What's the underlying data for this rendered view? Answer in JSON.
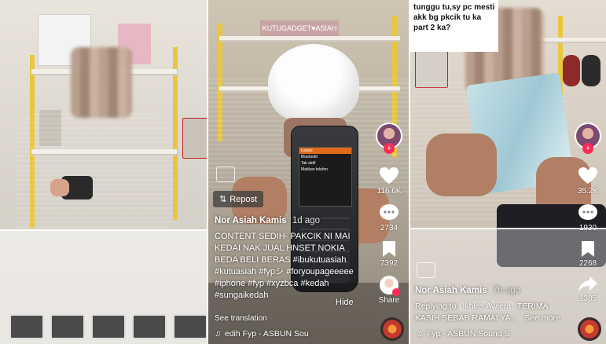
{
  "panel1": {
    "overlay_label": "KUTUGADGET ASIAH"
  },
  "panel2": {
    "sign_text": "KUTUGADGET♥ASIAH",
    "repost_label": "Repost",
    "username": "Nor Asiah Kamis",
    "time_ago": "1d ago",
    "caption_lines": [
      "CONTENT SEDIH- PAKCIK NI MAI",
      "KEDAI NAK JUAL HNSET NOKIA",
      "BEDA BELI BERAS #ibukutuasiah",
      "#kutuasiah #fypシ #foryoupageeeee",
      "#iphone #fyp #xyzbca #kedah",
      "#sungaikedah"
    ],
    "hide_label": "Hide",
    "see_translation": "See translation",
    "music": "edih Fyp - ASBUN    Sou",
    "likes": "116.6K",
    "comments": "2734",
    "saves": "7392",
    "share_label": "Share",
    "phone_screen": [
      "Lokasi",
      "Bluetooth",
      "Tak aktif",
      "Matikan telefon"
    ]
  },
  "panel3": {
    "comment_box": "tunggu tu,sy pc mesti akk bg pkcik tu ka part 2 ka?",
    "username": "Nor Asiah Kamis",
    "time_ago": "7h ago",
    "replying_prefix": "Replying to",
    "replying_user": "Ikhlas Awiera",
    "reply_text": "TERIMA",
    "reply_text2": "KASIH SEBAB RAMAI YA...",
    "see_more": "See more",
    "music": "Fyp - ASBUN    Sound S",
    "likes": "35.2K",
    "comments": "1930",
    "saves": "2268",
    "shares": "1305"
  },
  "colors": {
    "accent": "#fe2c55",
    "shirt": "#4a63a3",
    "shelf": "#e8c640"
  }
}
